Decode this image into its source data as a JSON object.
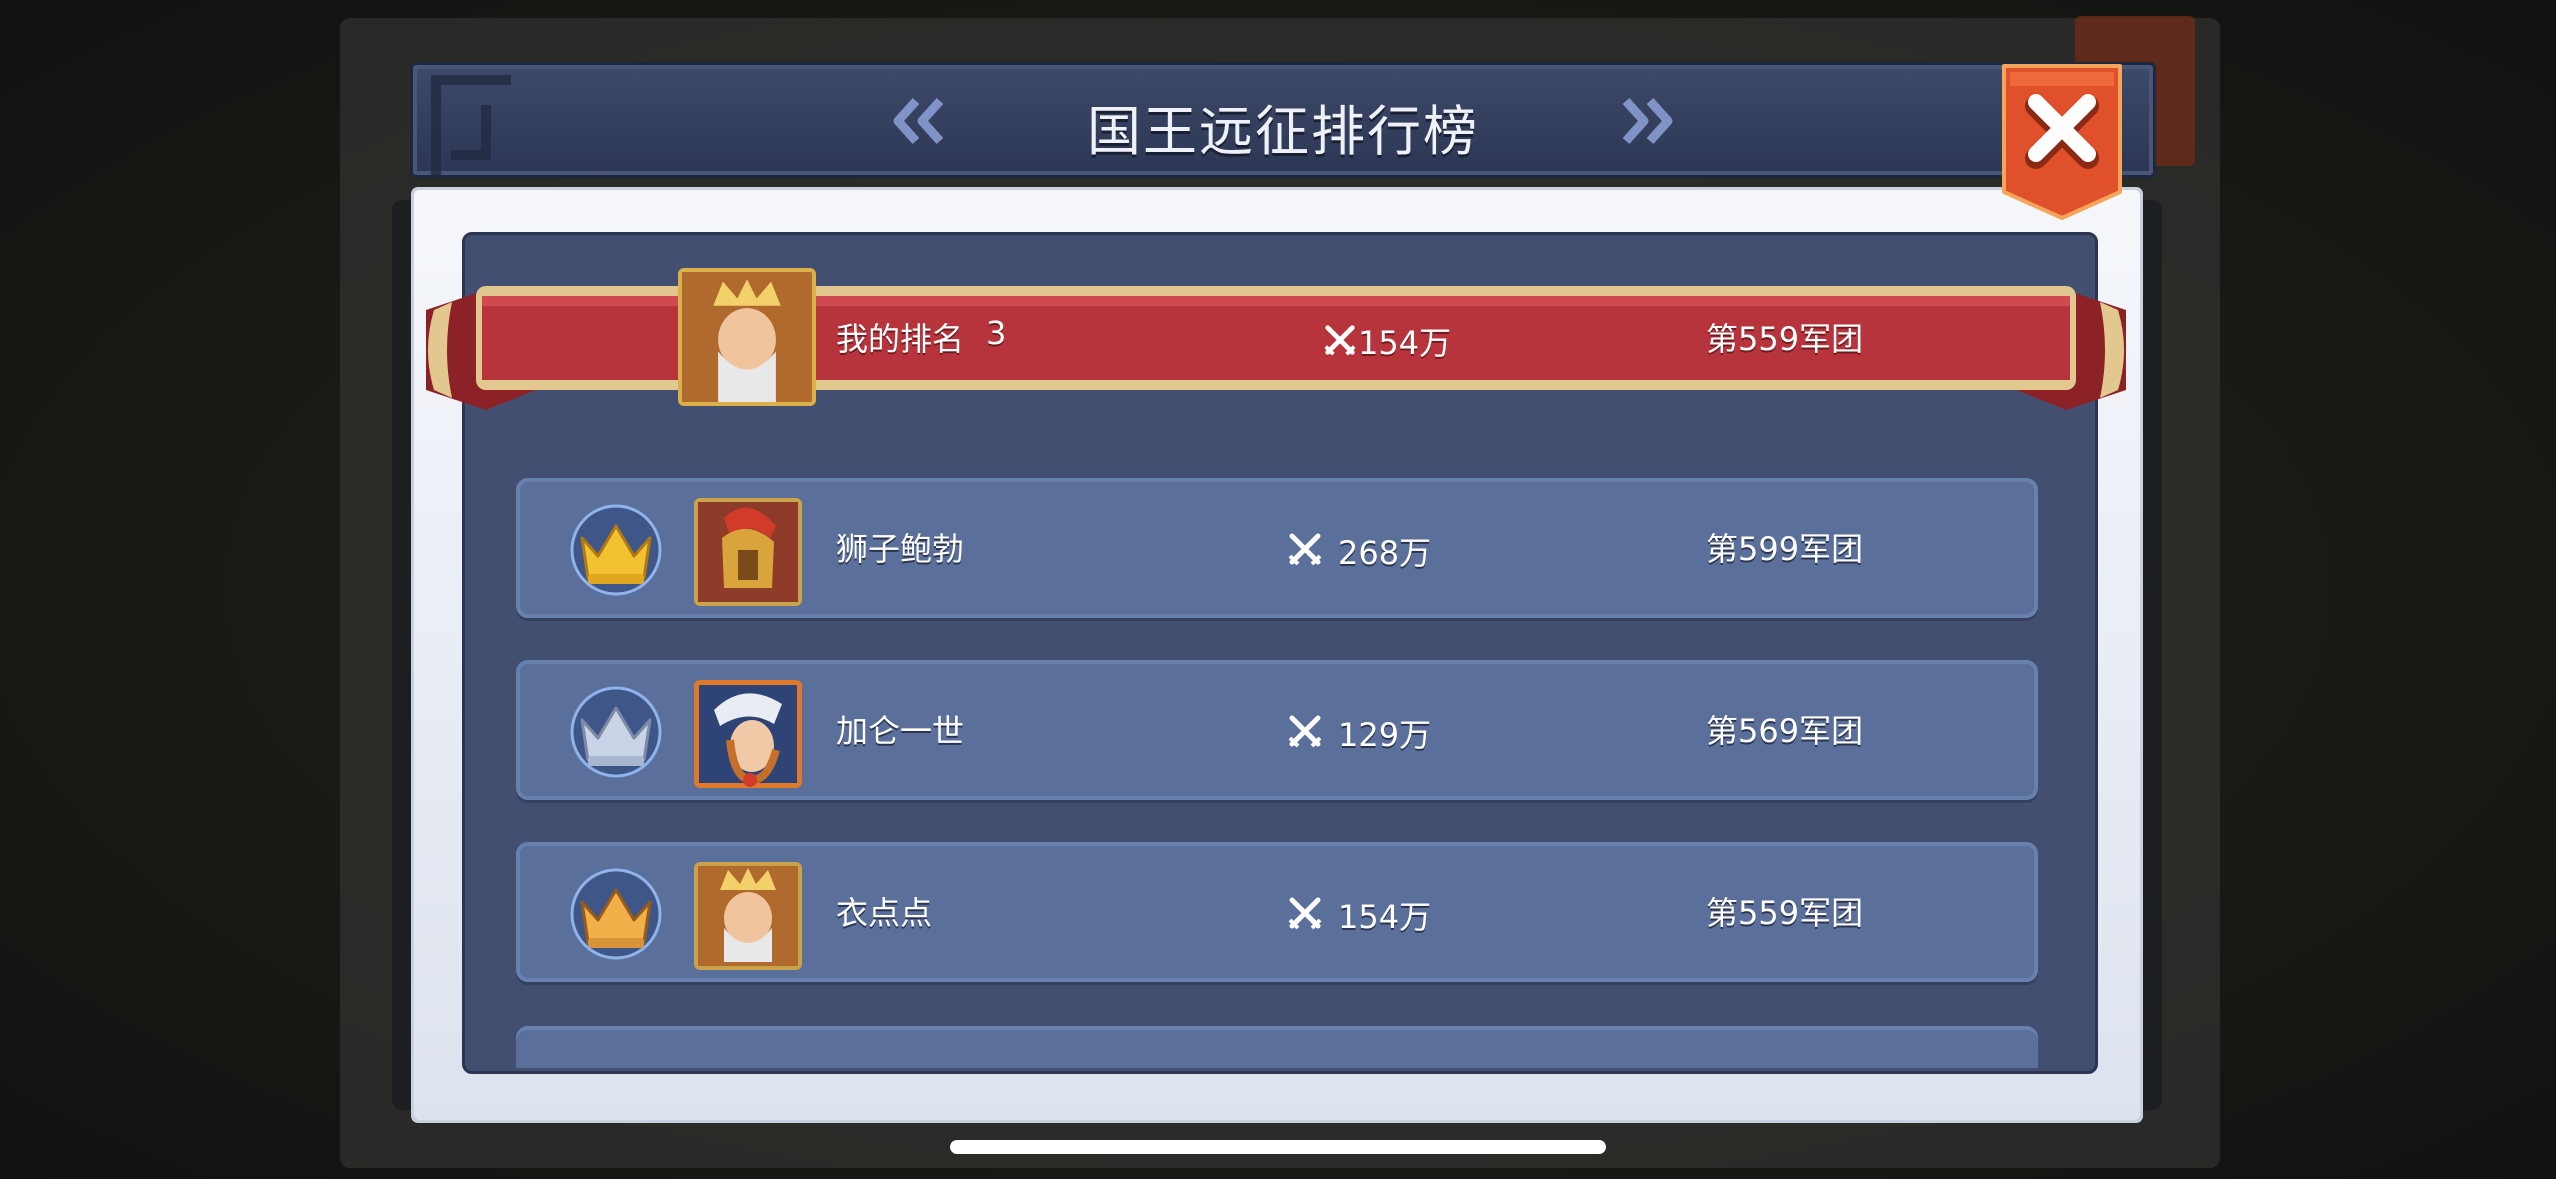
{
  "header": {
    "title": "国王远征排行榜"
  },
  "my_rank": {
    "label": "我的排名",
    "rank": "3",
    "power": "154万",
    "legion": "第559军团"
  },
  "rows": [
    {
      "rank": "1",
      "name": "狮子鲍勃",
      "power": "268万",
      "legion": "第599军团",
      "crown": "gold-crown"
    },
    {
      "rank": "2",
      "name": "加仑一世",
      "power": "129万",
      "legion": "第569军团",
      "crown": "silver-crown"
    },
    {
      "rank": "3",
      "name": "衣点点",
      "power": "154万",
      "legion": "第559军团",
      "crown": "bronze-crown"
    }
  ],
  "colors": {
    "ribbon": "#b8343c",
    "panel": "#424f70",
    "row": "#5a6f9a",
    "close": "#e0502a"
  }
}
